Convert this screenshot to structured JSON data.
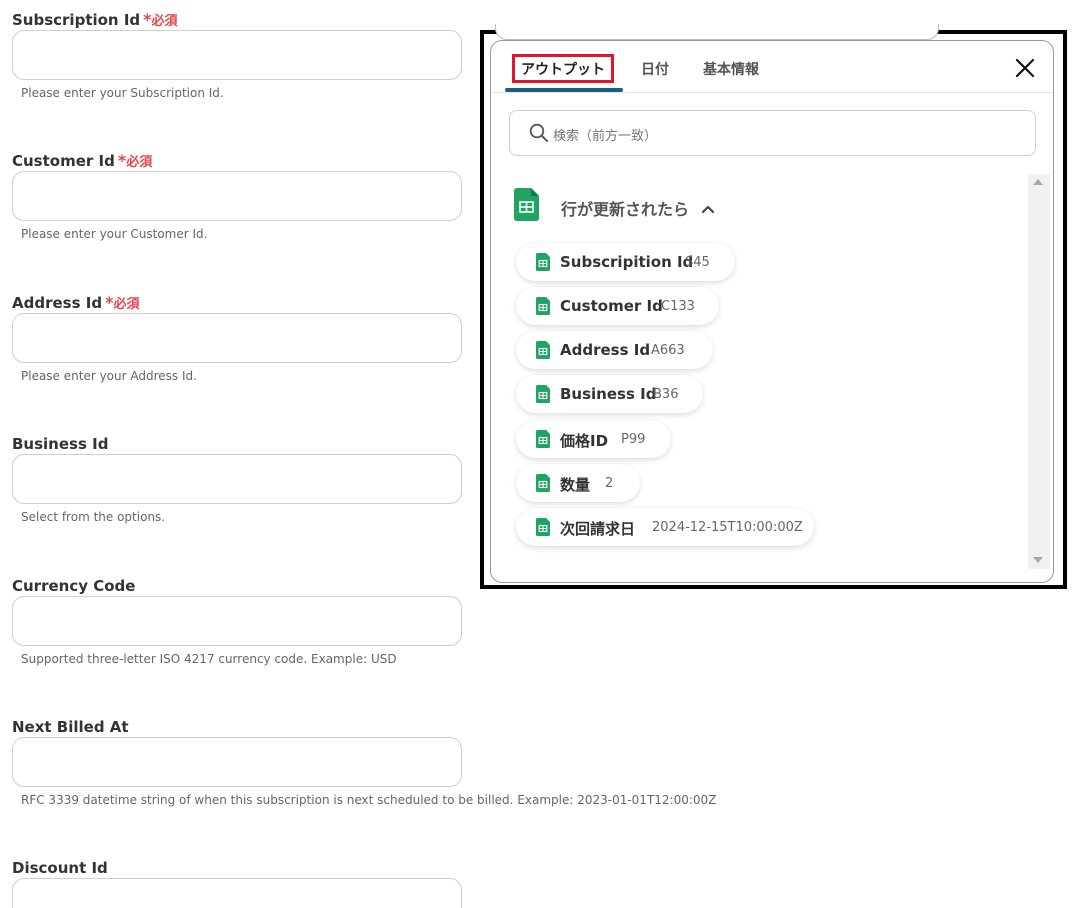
{
  "required_text": "必須",
  "form": {
    "fields": [
      {
        "label": "Subscription Id",
        "required": true,
        "help": "Please enter your Subscription Id."
      },
      {
        "label": "Customer Id",
        "required": true,
        "help": "Please enter your Customer Id."
      },
      {
        "label": "Address Id",
        "required": true,
        "help": "Please enter your Address Id."
      },
      {
        "label": "Business Id",
        "required": false,
        "help": "Select from the options."
      },
      {
        "label": "Currency Code",
        "required": false,
        "help": "Supported three-letter ISO 4217 currency code. Example: USD"
      },
      {
        "label": "Next Billed At",
        "required": false,
        "help": "RFC 3339 datetime string of when this subscription is next scheduled to be billed. Example: 2023-01-01T12:00:00Z"
      },
      {
        "label": "Discount Id",
        "required": false,
        "help": ""
      }
    ]
  },
  "panel": {
    "tabs": [
      {
        "label": "アウトプット",
        "active": true
      },
      {
        "label": "日付",
        "active": false
      },
      {
        "label": "基本情報",
        "active": false
      }
    ],
    "search_placeholder": "検索（前方一致）",
    "group": {
      "title": "行が更新されたら",
      "icon": "google-sheets-icon",
      "expanded": true,
      "items": [
        {
          "label": "Subscripition Id",
          "value": "S45"
        },
        {
          "label": "Customer Id",
          "value": "C133"
        },
        {
          "label": "Address Id",
          "value": "A663"
        },
        {
          "label": "Business Id",
          "value": "B36"
        },
        {
          "label": "価格ID",
          "value": "P99"
        },
        {
          "label": "数量",
          "value": "2"
        },
        {
          "label": "次回請求日",
          "value": "2024-12-15T10:00:00Z"
        }
      ]
    },
    "colors": {
      "active_tab_underline": "#1a5f7a",
      "highlight_box": "#e0162b",
      "required": "#e2474c",
      "sheets_green": "#1fa463"
    }
  }
}
